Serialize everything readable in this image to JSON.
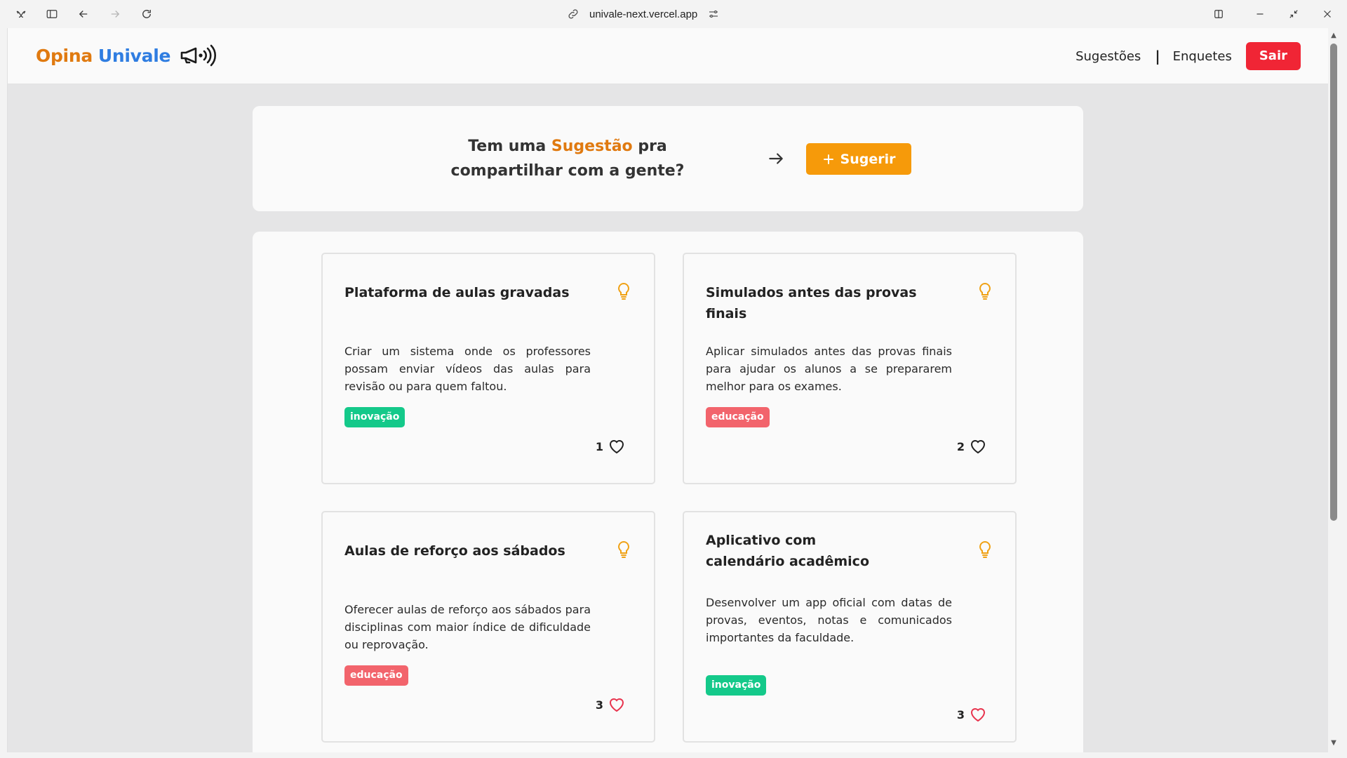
{
  "browser": {
    "url": "univale-next.vercel.app"
  },
  "header": {
    "logo_part1": "Opina",
    "logo_part2": "Univale",
    "nav": {
      "sugestoes": "Sugestões",
      "separator": "|",
      "enquetes": "Enquetes",
      "sair": "Sair"
    }
  },
  "banner": {
    "text_before": "Tem uma",
    "text_highlight": "Sugestão",
    "text_after": "pra compartilhar com a gente?",
    "button_label": "Sugerir"
  },
  "cards": [
    {
      "title": "Plataforma de aulas gravadas",
      "description": "Criar um sistema onde os professores possam enviar vídeos das aulas para revisão ou para quem faltou.",
      "tag": "inovação",
      "likes": "1",
      "liked": false
    },
    {
      "title": "Simulados antes das provas finais",
      "description": "Aplicar simulados antes das provas finais para ajudar os alunos a se prepararem melhor para os exames.",
      "tag": "educação",
      "likes": "2",
      "liked": false
    },
    {
      "title": "Aulas de reforço aos sábados",
      "description": "Oferecer aulas de reforço aos sábados para disciplinas com maior índice de dificuldade ou reprovação.",
      "tag": "educação",
      "likes": "3",
      "liked": true
    },
    {
      "title": "Aplicativo com calendário acadêmico",
      "description": "Desenvolver um app oficial com datas de provas, eventos, notas e comunicados importantes da faculdade.",
      "tag": "inovação",
      "likes": "3",
      "liked": true
    }
  ],
  "colors": {
    "accent_orange": "#e07a10",
    "accent_blue": "#2f7de1",
    "button_orange": "#f69a0a",
    "logout_red": "#f02535",
    "tag_inovacao": "#14c98a",
    "tag_educacao": "#f2646c",
    "heart_liked": "#e8334d"
  }
}
